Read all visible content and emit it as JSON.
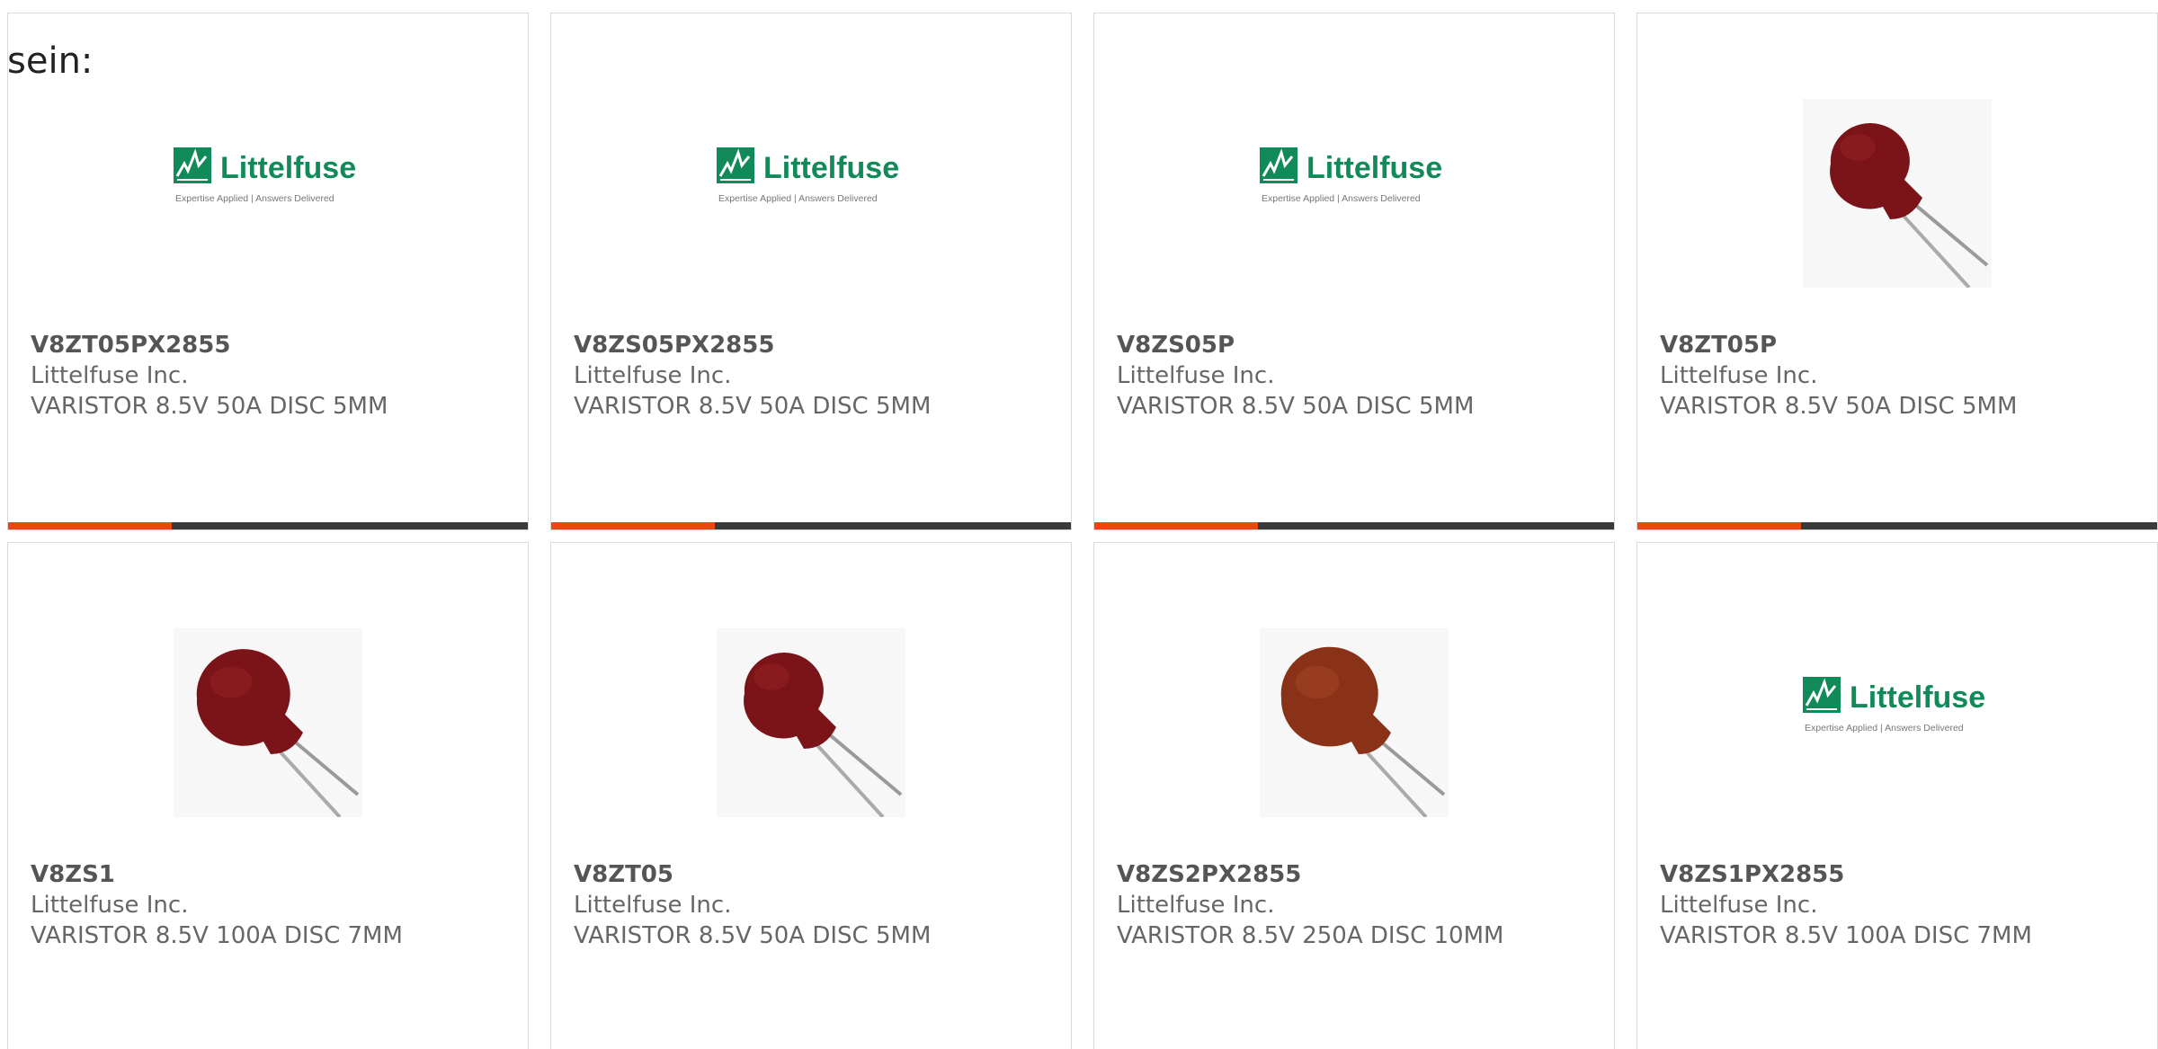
{
  "intro_text": "sein:",
  "colors": {
    "accent": "#e8470e",
    "bar": "#3a3a3a",
    "logo_green": "#118a5a",
    "varistor_dark": "#7a1418",
    "varistor_brown": "#8a3218"
  },
  "products": [
    {
      "part_number": "V8ZT05PX2855",
      "manufacturer": "Littelfuse Inc.",
      "description": "VARISTOR 8.5V 50A DISC 5MM",
      "image": "littelfuse-logo",
      "logo_brand": "Littelfuse",
      "logo_tagline": "Expertise Applied | Answers Delivered"
    },
    {
      "part_number": "V8ZS05PX2855",
      "manufacturer": "Littelfuse Inc.",
      "description": "VARISTOR 8.5V 50A DISC 5MM",
      "image": "littelfuse-logo",
      "logo_brand": "Littelfuse",
      "logo_tagline": "Expertise Applied | Answers Delivered"
    },
    {
      "part_number": "V8ZS05P",
      "manufacturer": "Littelfuse Inc.",
      "description": "VARISTOR 8.5V 50A DISC 5MM",
      "image": "littelfuse-logo",
      "logo_brand": "Littelfuse",
      "logo_tagline": "Expertise Applied | Answers Delivered"
    },
    {
      "part_number": "V8ZT05P",
      "manufacturer": "Littelfuse Inc.",
      "description": "VARISTOR 8.5V 50A DISC 5MM",
      "image": "varistor-photo-small"
    },
    {
      "part_number": "V8ZS1",
      "manufacturer": "Littelfuse Inc.",
      "description": "VARISTOR 8.5V 100A DISC 7MM",
      "image": "varistor-photo"
    },
    {
      "part_number": "V8ZT05",
      "manufacturer": "Littelfuse Inc.",
      "description": "VARISTOR 8.5V 50A DISC 5MM",
      "image": "varistor-photo-small"
    },
    {
      "part_number": "V8ZS2PX2855",
      "manufacturer": "Littelfuse Inc.",
      "description": "VARISTOR 8.5V 250A DISC 10MM",
      "image": "varistor-photo-brown"
    },
    {
      "part_number": "V8ZS1PX2855",
      "manufacturer": "Littelfuse Inc.",
      "description": "VARISTOR 8.5V 100A DISC 7MM",
      "image": "littelfuse-logo",
      "logo_brand": "Littelfuse",
      "logo_tagline": "Expertise Applied | Answers Delivered"
    }
  ]
}
